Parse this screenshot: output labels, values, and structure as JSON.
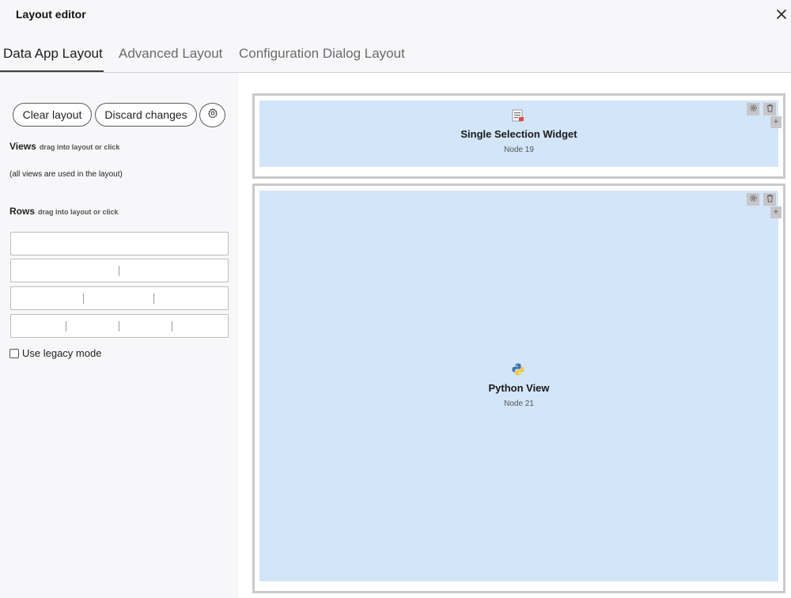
{
  "dialog": {
    "title": "Layout editor"
  },
  "tabs": [
    {
      "label": "Data App Layout",
      "active": true
    },
    {
      "label": "Advanced Layout",
      "active": false
    },
    {
      "label": "Configuration Dialog Layout",
      "active": false
    }
  ],
  "sidebar": {
    "clear_label": "Clear layout",
    "discard_label": "Discard changes",
    "settings_icon": "gear-icon",
    "views": {
      "title": "Views",
      "hint": "drag into layout or click",
      "note": "(all views are used in the layout)"
    },
    "rows": {
      "title": "Rows",
      "hint": "drag into layout or click",
      "templates": [
        1,
        2,
        3,
        4
      ]
    },
    "legacy": {
      "label": "Use legacy mode",
      "checked": false
    }
  },
  "layout": {
    "rows": [
      {
        "title": "Single Selection Widget",
        "node": "Node 19",
        "icon": "selection-widget-icon"
      },
      {
        "title": "Python View",
        "node": "Node 21",
        "icon": "python-icon"
      }
    ]
  },
  "colors": {
    "panel": "#d3e5f8",
    "frame": "#c9c9cd",
    "sidebar": "#f7f7f9"
  }
}
